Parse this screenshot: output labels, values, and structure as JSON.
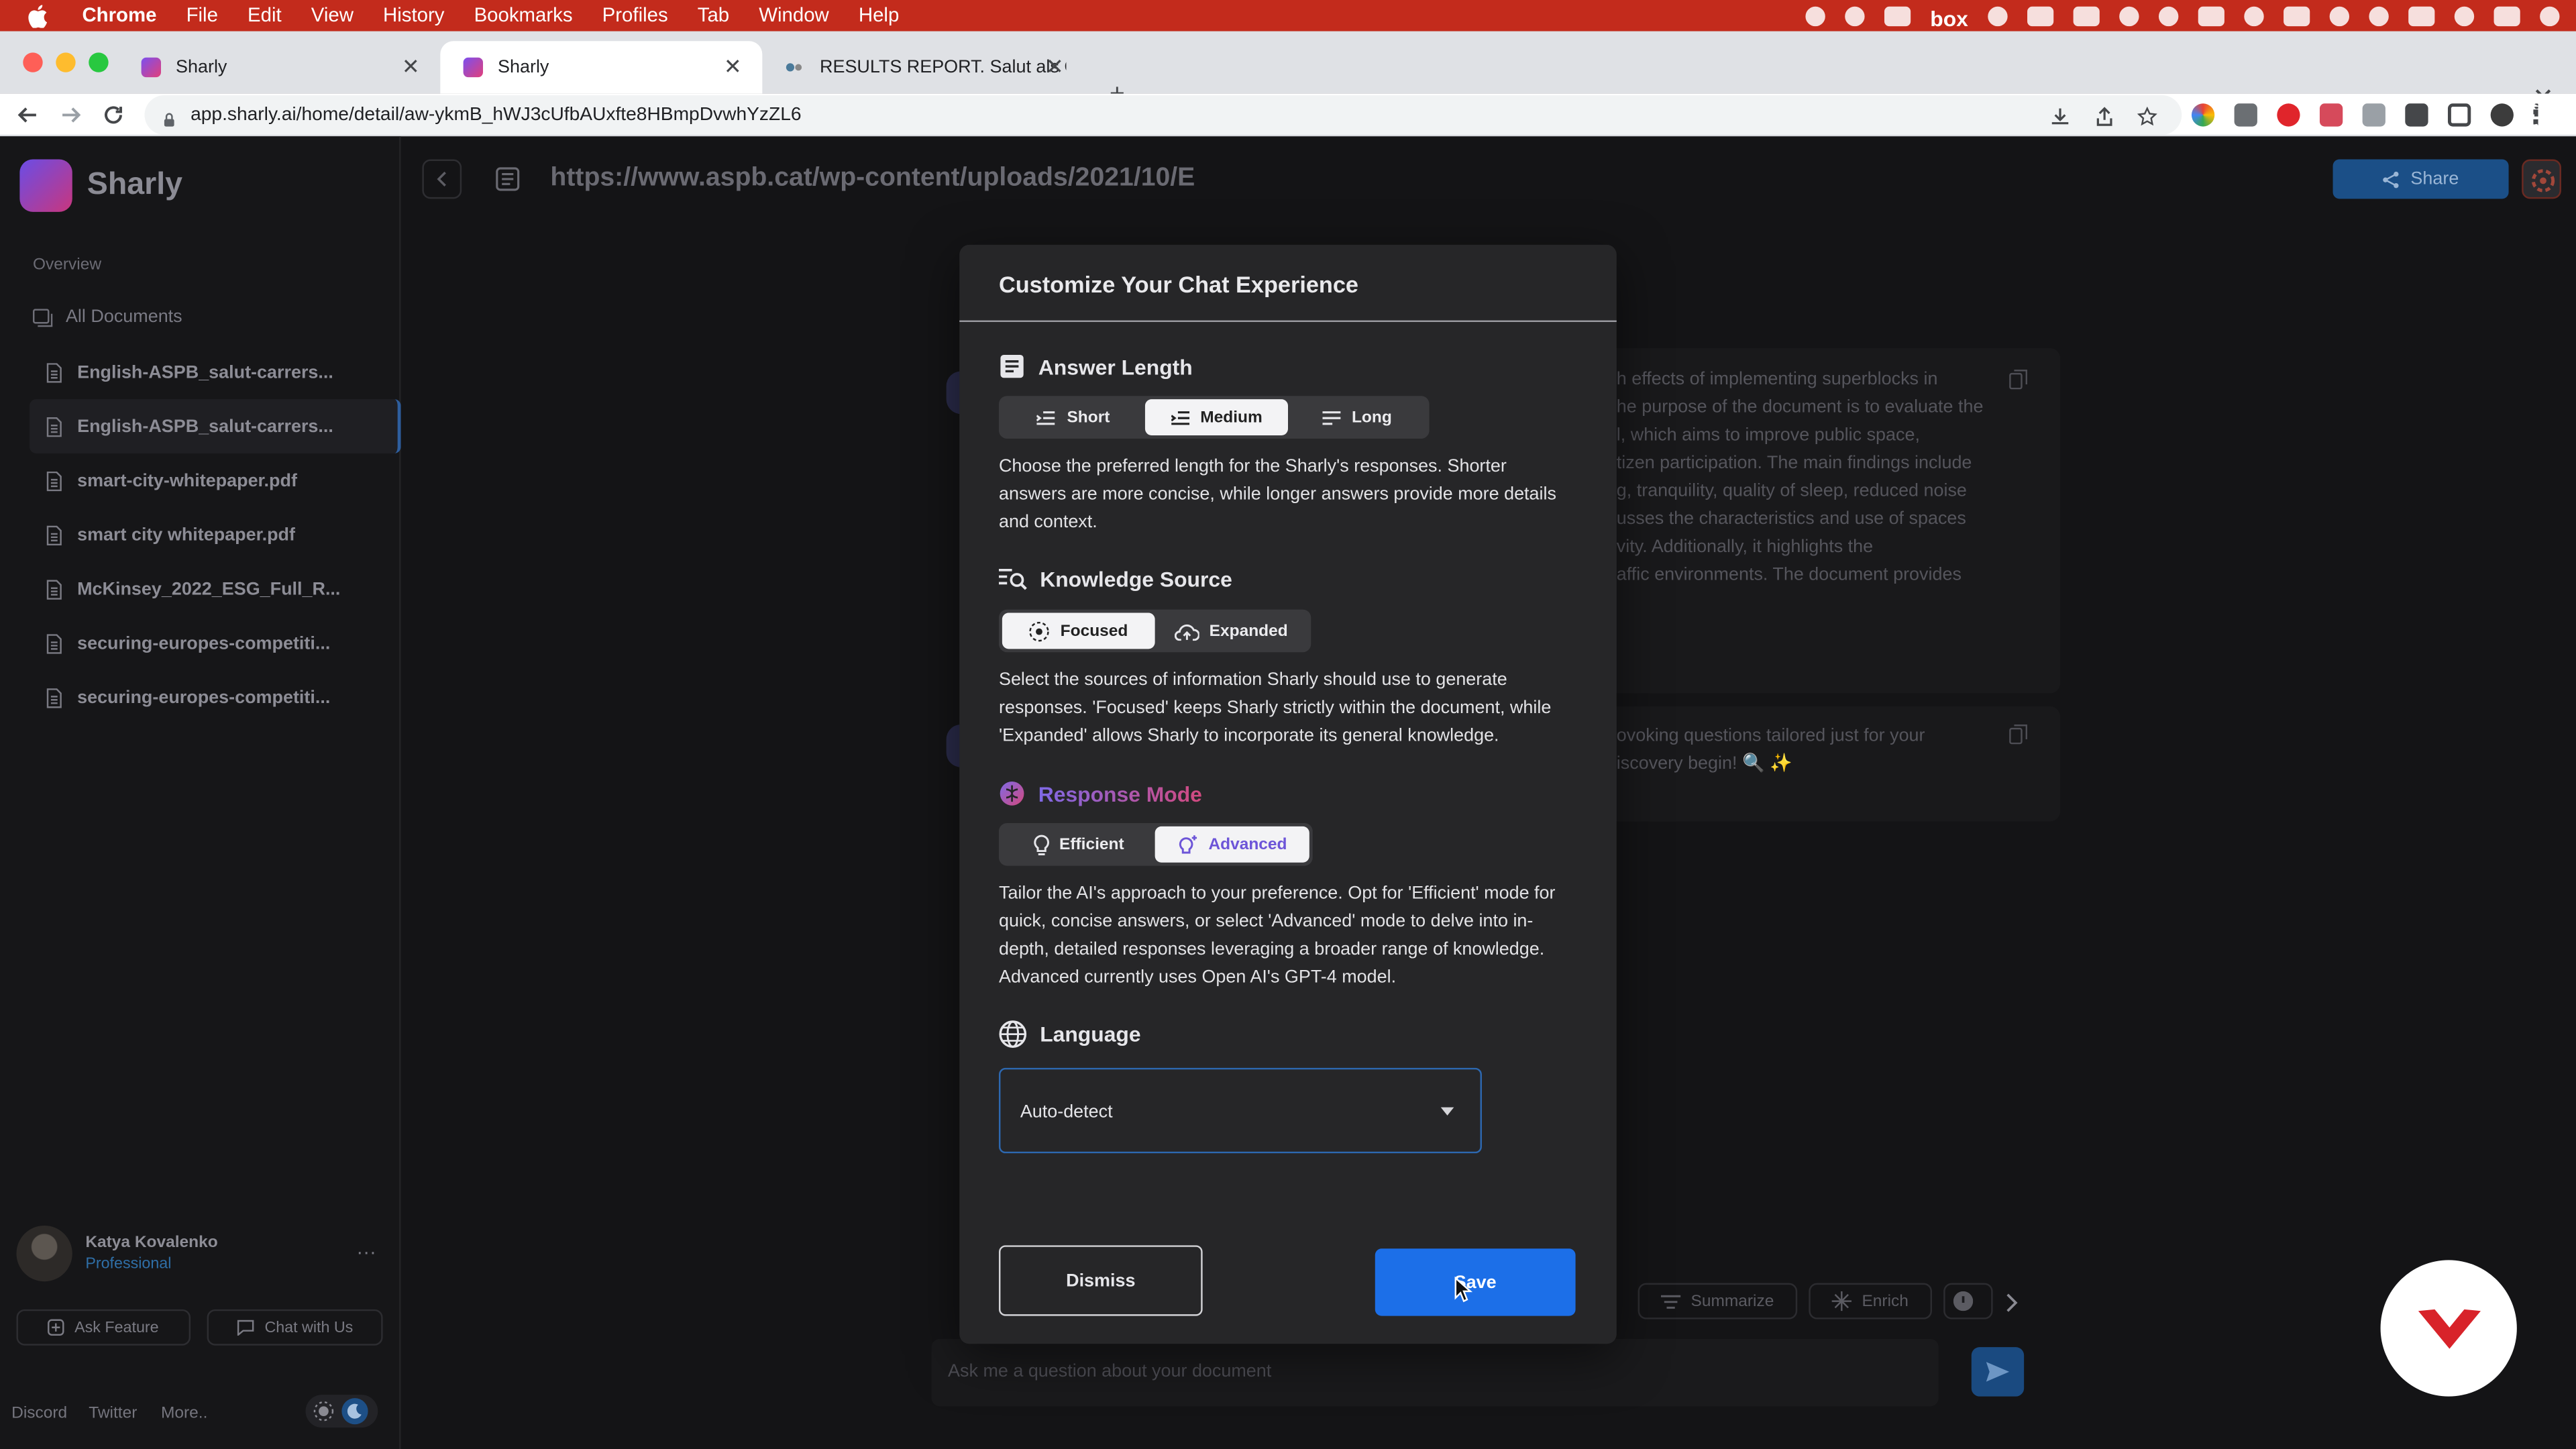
{
  "menubar": {
    "app": "Chrome",
    "items": [
      "File",
      "Edit",
      "View",
      "History",
      "Bookmarks",
      "Profiles",
      "Tab",
      "Window",
      "Help"
    ],
    "box_label": "box"
  },
  "tabs": [
    {
      "title": "Sharly"
    },
    {
      "title": "Sharly"
    },
    {
      "title": "RESULTS REPORT. Salut als Ca"
    }
  ],
  "address_bar": {
    "url": "app.sharly.ai/home/detail/aw-ykmB_hWJ3cUfbAUxfte8HBmpDvwhYzZL6"
  },
  "sidebar": {
    "brand": "Sharly",
    "overview": "Overview",
    "all_documents": "All Documents",
    "documents": [
      "English-ASPB_salut-carrers...",
      "English-ASPB_salut-carrers...",
      "smart-city-whitepaper.pdf",
      "smart city whitepaper.pdf",
      "McKinsey_2022_ESG_Full_R...",
      "securing-europes-competiti...",
      "securing-europes-competiti..."
    ],
    "user": {
      "name": "Katya Kovalenko",
      "plan": "Professional"
    },
    "ask_feature": "Ask Feature",
    "chat_with_us": "Chat with Us",
    "footer_links": [
      "Discord",
      "Twitter",
      "More.."
    ]
  },
  "topbar": {
    "doc_url": "https://www.aspb.cat/wp-content/uploads/2021/10/E",
    "share": "Share"
  },
  "background_chat": {
    "summary_lines": [
      "h effects of implementing superblocks in",
      "he purpose of the document is to evaluate the",
      "l, which aims to improve public space,",
      "tizen participation. The main findings include",
      "g, tranquility, quality of sleep, reduced noise",
      "usses the characteristics and use of spaces",
      "vity. Additionally, it highlights the",
      "affic environments. The document provides"
    ],
    "second_lines": [
      "ovoking questions tailored just for your",
      "iscovery begin! 🔍 ✨"
    ],
    "actions": [
      "Summarize",
      "Enrich"
    ],
    "ask_placeholder": "Ask me a question about your document"
  },
  "modal": {
    "title": "Customize Your Chat Experience",
    "answer_length": {
      "title": "Answer Length",
      "options": [
        "Short",
        "Medium",
        "Long"
      ],
      "selected": "Medium",
      "description": "Choose the preferred length for the Sharly's responses. Shorter answers are more concise, while longer answers provide more details and context."
    },
    "knowledge_source": {
      "title": "Knowledge Source",
      "options": [
        "Focused",
        "Expanded"
      ],
      "selected": "Focused",
      "description": "Select the sources of information Sharly should use to generate responses. 'Focused' keeps Sharly strictly within the document, while 'Expanded' allows Sharly to incorporate its general knowledge."
    },
    "response_mode": {
      "title": "Response Mode",
      "options": [
        "Efficient",
        "Advanced"
      ],
      "selected": "Advanced",
      "description": "Tailor the AI's approach to your preference. Opt for 'Efficient' mode for quick, concise answers, or select 'Advanced' mode to delve into in-depth, detailed responses leveraging a broader range of knowledge. Advanced currently uses Open AI's GPT-4 model."
    },
    "language": {
      "title": "Language",
      "value": "Auto-detect"
    },
    "dismiss": "Dismiss",
    "save": "Save"
  },
  "colors": {
    "menubar": "#c32b1c",
    "accent_blue": "#1c6fe8",
    "brand_gradient_start": "#6a4de6",
    "brand_gradient_end": "#c9367d"
  }
}
